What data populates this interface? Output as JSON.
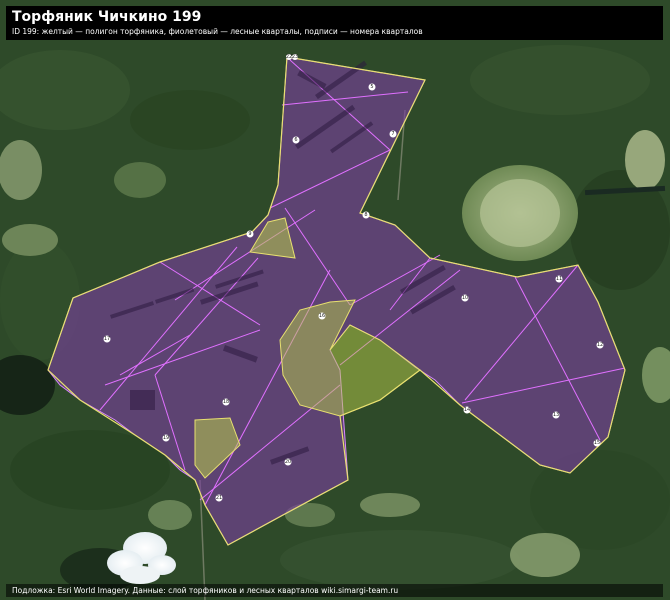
{
  "map": {
    "title": "Торфяник Чичкино 199",
    "subtitle": "ID 199: желтый — полигон торфяника, фиолетовый — лесные кварталы, подписи — номера кварталов",
    "attribution": "Подложка: Esri World Imagery. Данные: слой торфяников и лесных кварталов wiki.simargi-team.ru",
    "basemap": "satellite imagery",
    "colors": {
      "peat_outline": "#e8e070",
      "peat_fill": "#c8d24a",
      "quarter_fill": "#7a3fa0",
      "quarter_line": "#e070ff"
    },
    "quarter_labels": [
      "5",
      "6",
      "7",
      "8",
      "9",
      "10",
      "11",
      "12",
      "13",
      "14",
      "15",
      "16",
      "17",
      "18",
      "19",
      "20",
      "21",
      "22",
      "23",
      "24",
      "25"
    ]
  }
}
